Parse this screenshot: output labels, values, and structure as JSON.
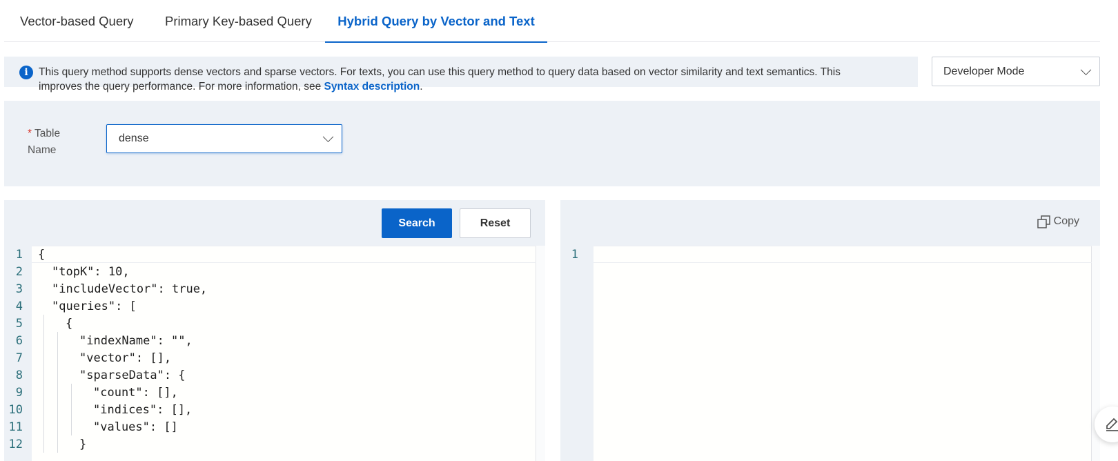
{
  "tabs": [
    {
      "label": "Vector-based Query",
      "active": false
    },
    {
      "label": "Primary Key-based Query",
      "active": false
    },
    {
      "label": "Hybrid Query by Vector and Text",
      "active": true
    }
  ],
  "info": {
    "icon": "info-icon",
    "line1": "This query method supports dense vectors and sparse vectors. For texts, you can use this query method to query data based on vector similarity and text semantics. This",
    "line2_prefix": "improves the query performance. For more information, see ",
    "link": "Syntax description",
    "line2_suffix": "."
  },
  "mode_select": {
    "value": "Developer Mode"
  },
  "form": {
    "table_name_label": "Table Name",
    "required_mark": "*",
    "table_name_value": "dense"
  },
  "actions": {
    "search_label": "Search",
    "reset_label": "Reset"
  },
  "editor": {
    "lines": [
      {
        "n": "1",
        "indent": 0,
        "text": "{"
      },
      {
        "n": "2",
        "indent": 1,
        "text": "\"topK\": 10,"
      },
      {
        "n": "3",
        "indent": 1,
        "text": "\"includeVector\": true,"
      },
      {
        "n": "4",
        "indent": 1,
        "text": "\"queries\": ["
      },
      {
        "n": "5",
        "indent": 2,
        "text": "{"
      },
      {
        "n": "6",
        "indent": 3,
        "text": "\"indexName\": \"\","
      },
      {
        "n": "7",
        "indent": 3,
        "text": "\"vector\": [],"
      },
      {
        "n": "8",
        "indent": 3,
        "text": "\"sparseData\": {"
      },
      {
        "n": "9",
        "indent": 4,
        "text": "\"count\": [],"
      },
      {
        "n": "10",
        "indent": 4,
        "text": "\"indices\": [],"
      },
      {
        "n": "11",
        "indent": 4,
        "text": "\"values\": []"
      },
      {
        "n": "12",
        "indent": 3,
        "text": "}"
      }
    ]
  },
  "result": {
    "copy_label": "Copy",
    "line_number": "1"
  },
  "colors": {
    "accent": "#0a64c9",
    "panel_bg": "#edf1f6",
    "required": "#d93026"
  }
}
